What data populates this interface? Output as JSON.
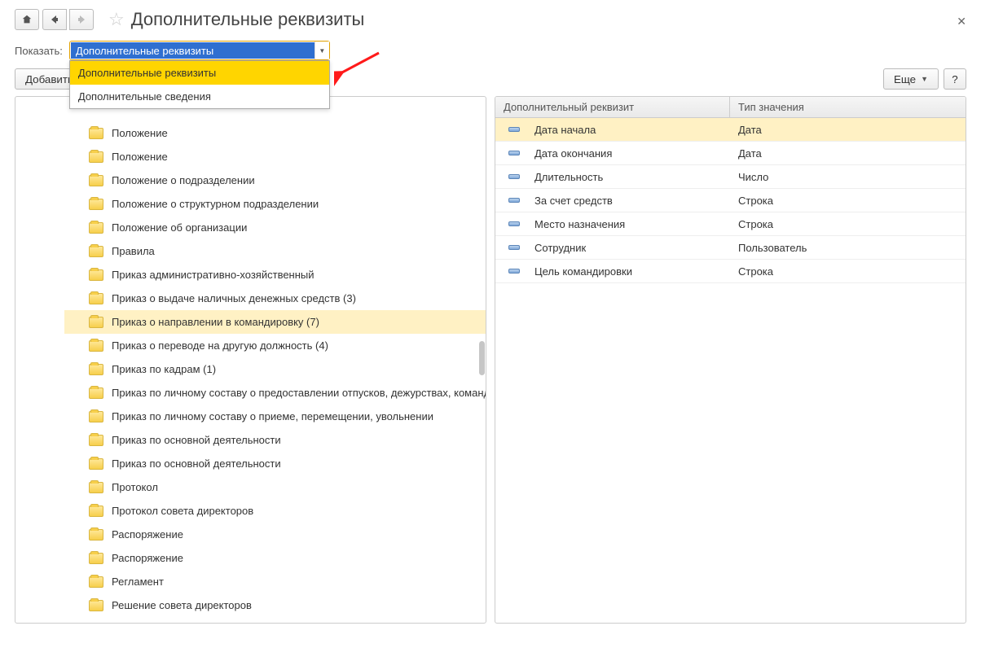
{
  "header": {
    "title": "Дополнительные реквизиты"
  },
  "filter": {
    "label": "Показать:",
    "value": "Дополнительные реквизиты",
    "options": [
      "Дополнительные реквизиты",
      "Дополнительные сведения"
    ]
  },
  "buttons": {
    "add": "Добавить",
    "more": "Еще",
    "help": "?"
  },
  "tree": {
    "items": [
      {
        "label": "Положение"
      },
      {
        "label": "Положение"
      },
      {
        "label": "Положение о подразделении"
      },
      {
        "label": "Положение о структурном подразделении"
      },
      {
        "label": "Положение об организации"
      },
      {
        "label": "Правила"
      },
      {
        "label": "Приказ административно-хозяйственный"
      },
      {
        "label": "Приказ о выдаче наличных денежных средств (3)"
      },
      {
        "label": "Приказ о направлении в командировку (7)",
        "hl": true
      },
      {
        "label": "Приказ о переводе на другую должность (4)"
      },
      {
        "label": "Приказ по кадрам (1)"
      },
      {
        "label": "Приказ по личному составу о предоставлении отпусков, дежурствах, командировках"
      },
      {
        "label": "Приказ по личному составу о приеме, перемещении, увольнении"
      },
      {
        "label": "Приказ по основной деятельности"
      },
      {
        "label": "Приказ по основной деятельности"
      },
      {
        "label": "Протокол"
      },
      {
        "label": "Протокол совета директоров"
      },
      {
        "label": "Распоряжение"
      },
      {
        "label": "Распоряжение"
      },
      {
        "label": "Регламент"
      },
      {
        "label": "Решение совета директоров"
      }
    ]
  },
  "table": {
    "headers": [
      "Дополнительный реквизит",
      "Тип значения"
    ],
    "rows": [
      {
        "name": "Дата начала",
        "type": "Дата",
        "hl": true
      },
      {
        "name": "Дата окончания",
        "type": "Дата"
      },
      {
        "name": "Длительность",
        "type": "Число"
      },
      {
        "name": "За счет средств",
        "type": "Строка"
      },
      {
        "name": "Место назначения",
        "type": "Строка"
      },
      {
        "name": "Сотрудник",
        "type": "Пользователь"
      },
      {
        "name": "Цель командировки",
        "type": "Строка"
      }
    ]
  }
}
